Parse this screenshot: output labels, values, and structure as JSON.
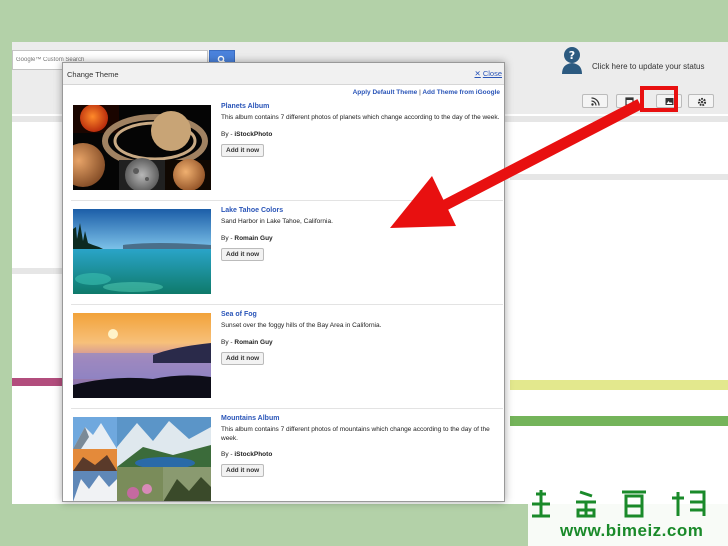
{
  "search": {
    "placeholder": "Google™ Custom Search",
    "button_icon": "search-icon"
  },
  "status": {
    "prompt": "Click here to update your status",
    "avatar_icon": "question-person-icon"
  },
  "toolbar": {
    "icons": [
      "rss-icon",
      "calendar-icon",
      "image-icon",
      "gear-icon"
    ]
  },
  "dialog": {
    "title": "Change Theme",
    "close_label": "Close",
    "apply_default_label": "Apply Default Theme",
    "separator": "|",
    "add_from_label": "Add Theme from iGoogle"
  },
  "themes": [
    {
      "name": "Planets Album",
      "description": "This album contains 7 different photos of planets which change according to the day of the week.",
      "by_prefix": "By - ",
      "author": "iStockPhoto",
      "button_label": "Add it now"
    },
    {
      "name": "Lake Tahoe Colors",
      "description": "Sand Harbor in Lake Tahoe, California.",
      "by_prefix": "By - ",
      "author": "Romain Guy",
      "button_label": "Add it now"
    },
    {
      "name": "Sea of Fog",
      "description": "Sunset over the foggy hills of the Bay Area in California.",
      "by_prefix": "By - ",
      "author": "Romain Guy",
      "button_label": "Add it now"
    },
    {
      "name": "Mountains Album",
      "description": "This album contains 7 different photos of mountains which change according to the day of the week.",
      "by_prefix": "By - ",
      "author": "iStockPhoto",
      "button_label": "Add it now"
    }
  ],
  "annotation": {
    "highlight_color": "#e81010"
  },
  "watermark": {
    "text": "www.bimeiz.com"
  }
}
